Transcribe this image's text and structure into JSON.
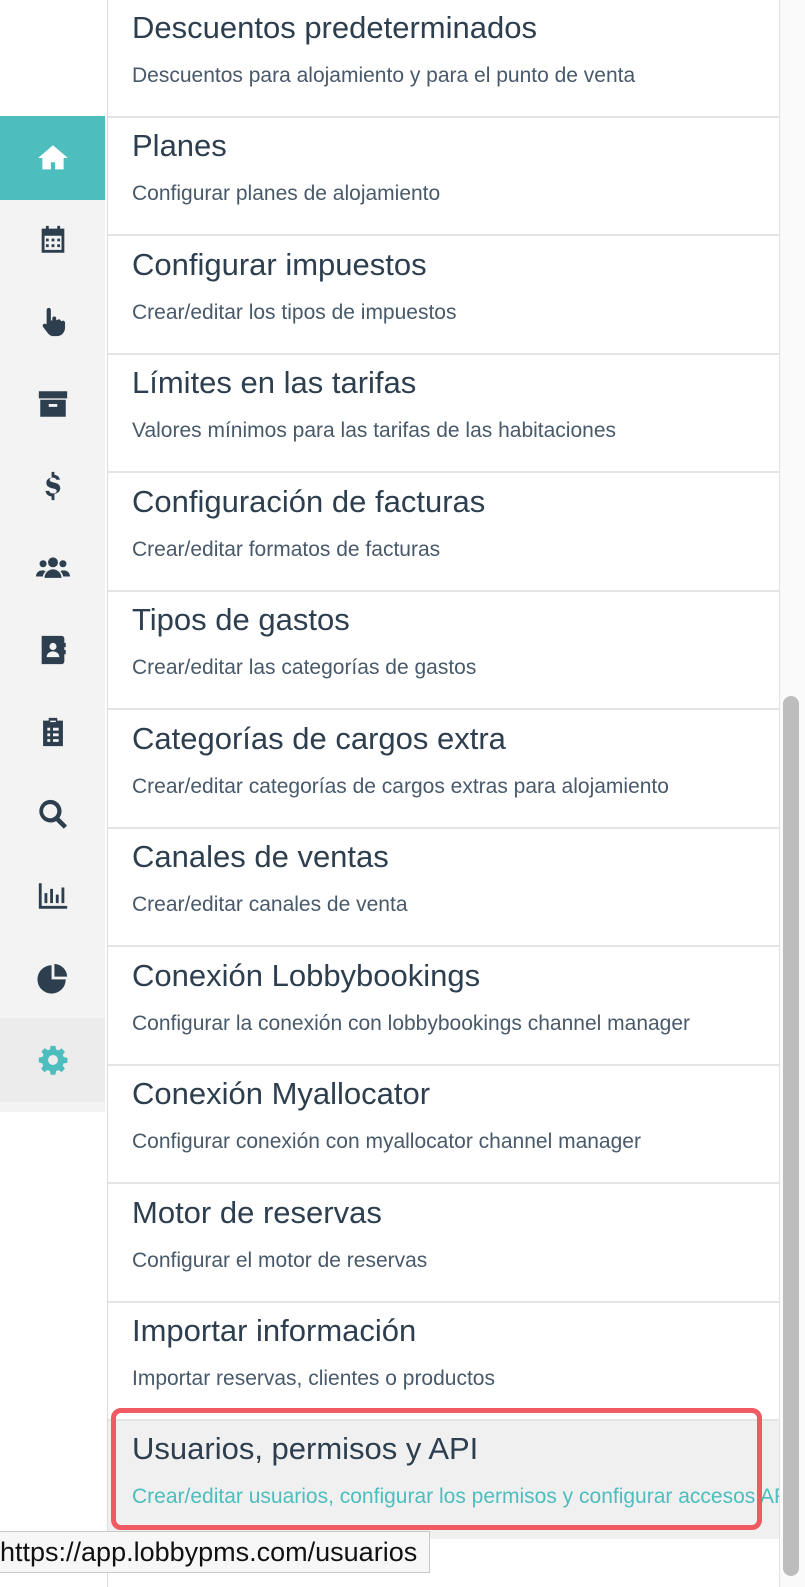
{
  "sidebar": {
    "items": [
      {
        "icon": "home-icon"
      },
      {
        "icon": "calendar-icon"
      },
      {
        "icon": "pointer-hand-icon"
      },
      {
        "icon": "archive-icon"
      },
      {
        "icon": "dollar-icon"
      },
      {
        "icon": "users-icon"
      },
      {
        "icon": "address-book-icon"
      },
      {
        "icon": "clipboard-list-icon"
      },
      {
        "icon": "search-icon"
      },
      {
        "icon": "bar-chart-icon"
      },
      {
        "icon": "pie-chart-icon"
      },
      {
        "icon": "gear-icon"
      }
    ],
    "colors": {
      "accent": "#4dbdbd",
      "icon": "#2d3e4f"
    }
  },
  "settings": {
    "items": [
      {
        "title": "Descuentos predeterminados",
        "desc": "Descuentos para alojamiento y para el punto de venta"
      },
      {
        "title": "Planes",
        "desc": "Configurar planes de alojamiento"
      },
      {
        "title": "Configurar impuestos",
        "desc": "Crear/editar los tipos de impuestos"
      },
      {
        "title": "Límites en las tarifas",
        "desc": "Valores mínimos para las tarifas de las habitaciones"
      },
      {
        "title": "Configuración de facturas",
        "desc": "Crear/editar formatos de facturas"
      },
      {
        "title": "Tipos de gastos",
        "desc": "Crear/editar las categorías de gastos"
      },
      {
        "title": "Categorías de cargos extra",
        "desc": "Crear/editar categorías de cargos extras para alojamiento"
      },
      {
        "title": "Canales de ventas",
        "desc": "Crear/editar canales de venta"
      },
      {
        "title": "Conexión Lobbybookings",
        "desc": "Configurar la conexión con lobbybookings channel manager"
      },
      {
        "title": "Conexión Myallocator",
        "desc": "Configurar conexión con myallocator channel manager"
      },
      {
        "title": "Motor de reservas",
        "desc": "Configurar el motor de reservas"
      },
      {
        "title": "Importar información",
        "desc": "Importar reservas, clientes o productos"
      },
      {
        "title": "Usuarios, permisos y API",
        "desc": "Crear/editar usuarios, configurar los permisos y configurar accesos API"
      }
    ]
  },
  "status_bar": {
    "url": "https://app.lobbypms.com/usuarios"
  }
}
